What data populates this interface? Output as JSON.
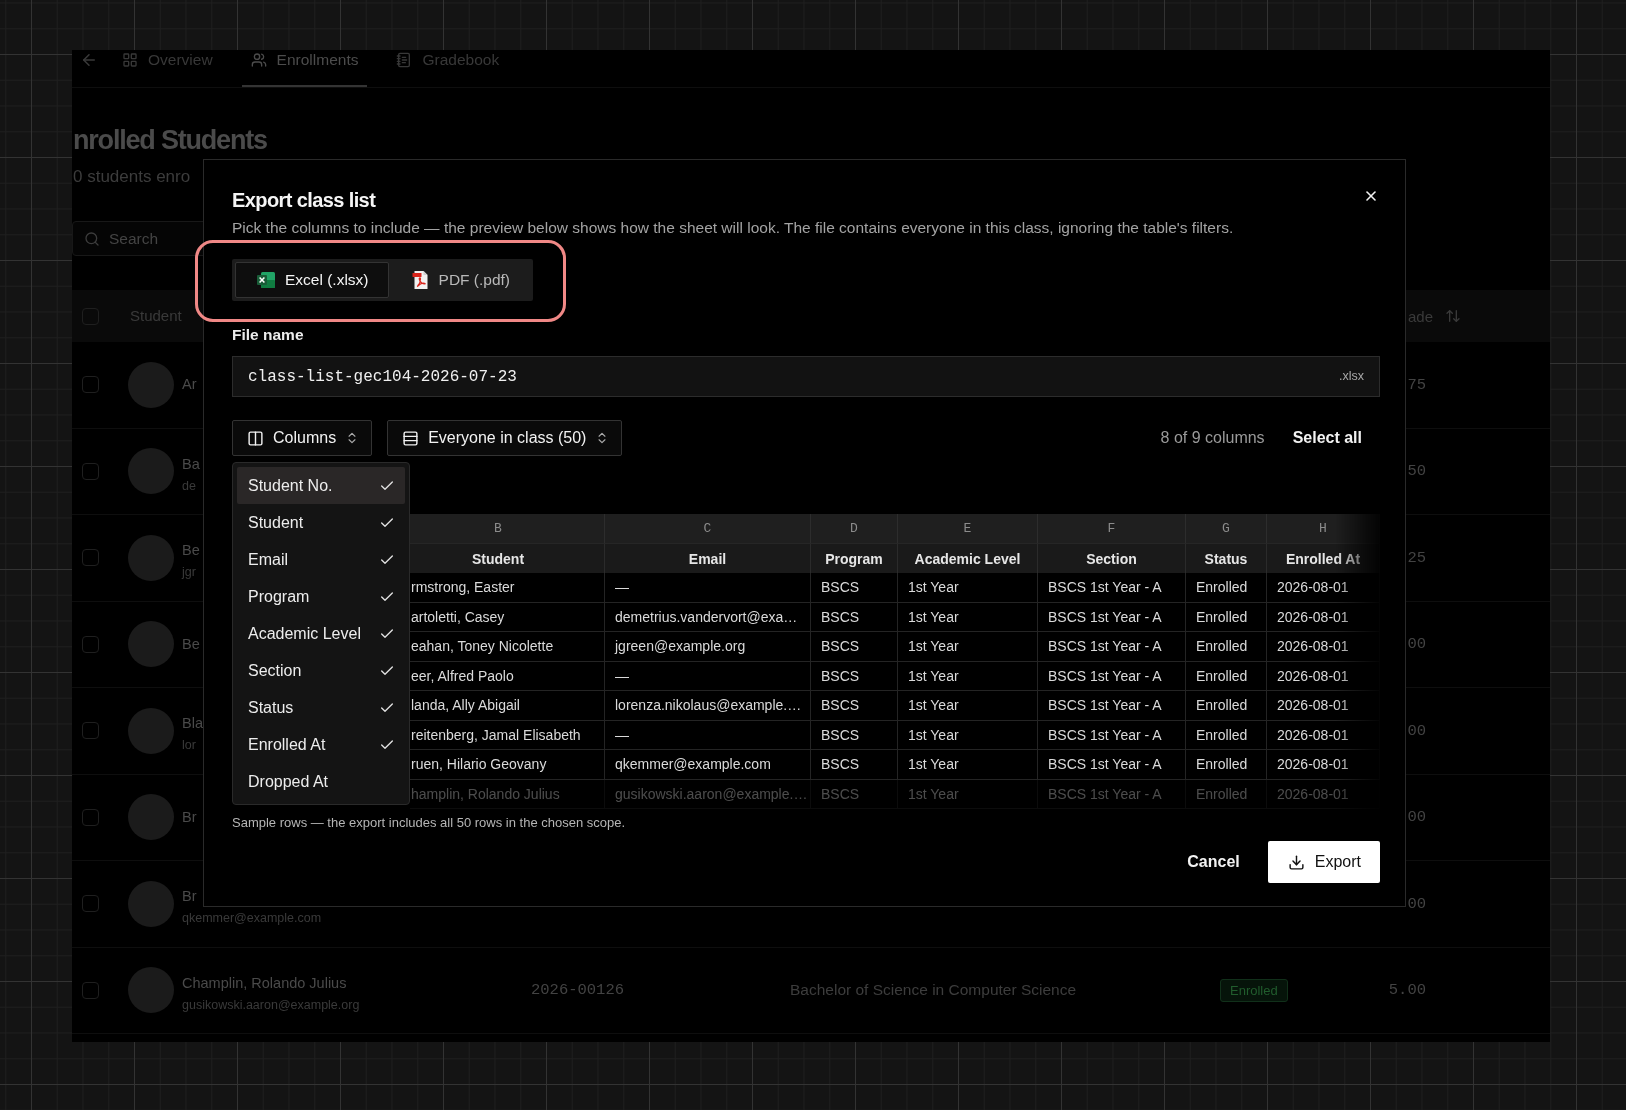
{
  "app": {
    "tabs": [
      {
        "label": "Overview",
        "kind": "overview",
        "selected": false
      },
      {
        "label": "Enrollments",
        "kind": "enrollments",
        "selected": true
      },
      {
        "label": "Gradebook",
        "kind": "gradebook",
        "selected": false
      }
    ],
    "title": "nrolled Students",
    "subtitle": "0 students enro",
    "search": {
      "placeholder": "Search"
    },
    "table": {
      "checked": false,
      "columns": [
        {
          "label": "Student"
        },
        {
          "label": "ade",
          "sortable": true
        }
      ],
      "rows": [
        {
          "checked": false,
          "name": "Ar",
          "grade": "75"
        },
        {
          "checked": false,
          "name": "Ba",
          "email": "de",
          "grade": "50"
        },
        {
          "checked": false,
          "name": "Be",
          "email": "jgr",
          "grade": "25"
        },
        {
          "checked": false,
          "name": "Be",
          "grade": "00"
        },
        {
          "checked": false,
          "name": "Bla",
          "email": "lor",
          "grade": "00"
        },
        {
          "checked": false,
          "name": "Br",
          "grade": "00"
        },
        {
          "checked": false,
          "name": "Br",
          "email": "qkemmer@example.com",
          "grade": "00"
        },
        {
          "checked": false,
          "name": "Champlin, Rolando Julius",
          "email": "gusikowski.aaron@example.org",
          "student_no": "2026-00126",
          "program": "Bachelor of Science in Computer Science",
          "status": "Enrolled",
          "grade": "5.00"
        }
      ]
    }
  },
  "dialog": {
    "title": "Export class list",
    "description": "Pick the columns to include — the preview below shows how the sheet will look. The file contains everyone in this class, ignoring the table's filters.",
    "format_picker": {
      "highlighted": true,
      "options": [
        {
          "label": "Excel (.xlsx)",
          "kind": "excel",
          "selected": true
        },
        {
          "label": "PDF (.pdf)",
          "kind": "pdf",
          "selected": false
        }
      ]
    },
    "file_name": {
      "label": "File name",
      "value": "class-list-gec104-2026-07-23",
      "suffix": ".xlsx"
    },
    "columns_button": {
      "label": "Columns"
    },
    "scope_button": {
      "label": "Everyone in class (50)"
    },
    "column_count": "8 of 9 columns",
    "select_all": "Select all",
    "column_menu": {
      "items": [
        {
          "label": "Student No.",
          "checked": true,
          "focused": true
        },
        {
          "label": "Student",
          "checked": true,
          "focused": false
        },
        {
          "label": "Email",
          "checked": true,
          "focused": false
        },
        {
          "label": "Program",
          "checked": true,
          "focused": false
        },
        {
          "label": "Academic Level",
          "checked": true,
          "focused": false
        },
        {
          "label": "Section",
          "checked": true,
          "focused": false
        },
        {
          "label": "Status",
          "checked": true,
          "focused": false
        },
        {
          "label": "Enrolled At",
          "checked": true,
          "focused": false
        },
        {
          "label": "Dropped At",
          "checked": false,
          "focused": false
        }
      ]
    },
    "preview": {
      "letters": [
        "B",
        "C",
        "D",
        "E",
        "F",
        "G",
        "H"
      ],
      "headers": [
        "Student",
        "Email",
        "Program",
        "Academic Level",
        "Section",
        "Status",
        "Enrolled At"
      ],
      "rows": [
        {
          "faded": false,
          "cells": [
            "rmstrong, Easter",
            "—",
            "BSCS",
            "1st Year",
            "BSCS 1st Year - A",
            "Enrolled",
            "2026-08-01"
          ]
        },
        {
          "faded": false,
          "cells": [
            "artoletti, Casey",
            "demetrius.vandervort@exa…",
            "BSCS",
            "1st Year",
            "BSCS 1st Year - A",
            "Enrolled",
            "2026-08-01"
          ]
        },
        {
          "faded": false,
          "cells": [
            "eahan, Toney Nicolette",
            "jgreen@example.org",
            "BSCS",
            "1st Year",
            "BSCS 1st Year - A",
            "Enrolled",
            "2026-08-01"
          ]
        },
        {
          "faded": false,
          "cells": [
            "eer, Alfred Paolo",
            "—",
            "BSCS",
            "1st Year",
            "BSCS 1st Year - A",
            "Enrolled",
            "2026-08-01"
          ]
        },
        {
          "faded": false,
          "cells": [
            "landa, Ally Abigail",
            "lorenza.nikolaus@example.…",
            "BSCS",
            "1st Year",
            "BSCS 1st Year - A",
            "Enrolled",
            "2026-08-01"
          ]
        },
        {
          "faded": false,
          "cells": [
            "reitenberg, Jamal Elisabeth",
            "—",
            "BSCS",
            "1st Year",
            "BSCS 1st Year - A",
            "Enrolled",
            "2026-08-01"
          ]
        },
        {
          "faded": false,
          "cells": [
            "ruen, Hilario Geovany",
            "qkemmer@example.com",
            "BSCS",
            "1st Year",
            "BSCS 1st Year - A",
            "Enrolled",
            "2026-08-01"
          ]
        },
        {
          "faded": true,
          "cells": [
            "hamplin, Rolando Julius",
            "gusikowski.aaron@example.…",
            "BSCS",
            "1st Year",
            "BSCS 1st Year - A",
            "Enrolled",
            "2026-08-01"
          ]
        }
      ],
      "caption": "Sample rows — the export includes all 50 rows in the chosen scope."
    },
    "cancel": "Cancel",
    "export": "Export"
  }
}
